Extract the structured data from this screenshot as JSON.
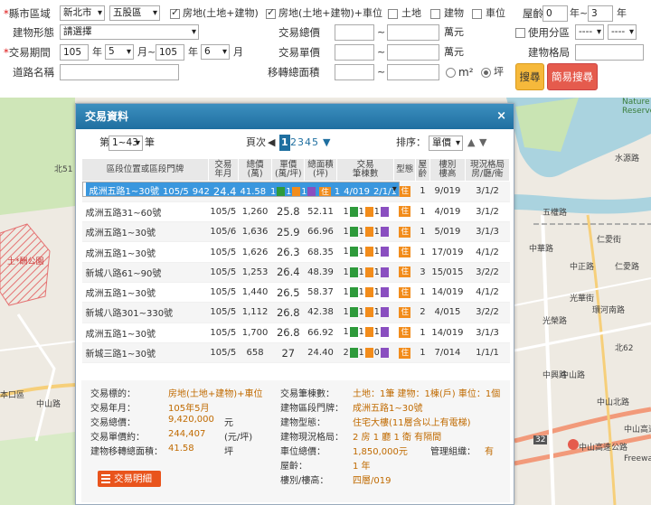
{
  "form": {
    "city_label": "縣市區域",
    "city": "新北市",
    "district": "五股區",
    "chk_land_building": "房地(土地+建物)",
    "chk_land_building_parking": "房地(土地+建物)+車位",
    "chk_land": "土地",
    "chk_building": "建物",
    "chk_parking": "車位",
    "age_label": "屋齡",
    "age_from": "0",
    "age_mid": "年~",
    "age_to": "3",
    "age_unit": "年",
    "type_label": "建物形態",
    "type_value": "請選擇",
    "total_price_label": "交易總價",
    "total_unit": "萬元",
    "zone_label": "使用分區",
    "zone_a": "----",
    "zone_b": "----",
    "period_label": "交易期間",
    "y1": "105",
    "m1": "5",
    "y2": "105",
    "m2": "6",
    "year_txt": "年",
    "month_tilde": "月~",
    "month_txt": "月",
    "unit_price_label": "交易單價",
    "unit_price_unit": "萬元",
    "layout_label": "建物格局",
    "road_label": "道路名稱",
    "area_label": "移轉總面積",
    "tilde": "~",
    "unit_m2": "m²",
    "unit_ping": "坪",
    "search_btn": "搜尋",
    "simple_btn": "簡易搜尋"
  },
  "map": {
    "labels": [
      "北51",
      "中山路",
      "中山高速公路",
      "環河南路",
      "仁愛路",
      "光榮路",
      "中正路",
      "中興路",
      "中山北路",
      "Nature",
      "Reserve",
      "水源路",
      "五權路",
      "北62",
      "中山路",
      "仁愛街",
      "光華街",
      "本口區",
      "中山高速公路",
      "中華路",
      "Freeway"
    ],
    "highway_badge": "32",
    "park_label": "土*酬公園"
  },
  "dialog": {
    "title": "交易資料",
    "close": "×",
    "page_prefix": "第",
    "page_select": "1~43",
    "page_suffix": "筆",
    "page_label": "頁次",
    "pages": [
      "1",
      "2",
      "3",
      "4",
      "5"
    ],
    "next": "▼",
    "sort_label": "排序：",
    "sort_value": "單價",
    "headers": [
      "區段位置或區段門牌",
      "交易\n年月",
      "總價\n(萬)",
      "單價\n(萬/坪)",
      "總面積\n(坪)",
      "交易\n筆棟數",
      "型態",
      "屋\n齡",
      "樓別\n樓高",
      "現況格局\n房/廳/衛"
    ],
    "type_tag": "住",
    "rows": [
      {
        "addr": "成洲五路1~30號",
        "ym": "105/5",
        "total": "942",
        "unit": "24.4",
        "area": "41.58",
        "n1": "1",
        "n2": "1",
        "n3": "1",
        "age": "1",
        "floor": "4/019",
        "layout": "2/1/1"
      },
      {
        "addr": "成洲五路31~60號",
        "ym": "105/5",
        "total": "1,238",
        "unit": "25.6",
        "area": "52.11",
        "n1": "1",
        "n2": "1",
        "n3": "1",
        "age": "1",
        "floor": "9/019",
        "layout": "3/1/2"
      },
      {
        "addr": "成洲五路31~60號",
        "ym": "105/5",
        "total": "1,260",
        "unit": "25.8",
        "area": "52.11",
        "n1": "1",
        "n2": "1",
        "n3": "1",
        "age": "1",
        "floor": "4/019",
        "layout": "3/1/2"
      },
      {
        "addr": "成洲五路1~30號",
        "ym": "105/6",
        "total": "1,636",
        "unit": "25.9",
        "area": "66.96",
        "n1": "1",
        "n2": "1",
        "n3": "1",
        "age": "1",
        "floor": "5/019",
        "layout": "3/1/3"
      },
      {
        "addr": "成洲五路1~30號",
        "ym": "105/5",
        "total": "1,626",
        "unit": "26.3",
        "area": "68.35",
        "n1": "1",
        "n2": "1",
        "n3": "1",
        "age": "1",
        "floor": "17/019",
        "layout": "4/1/2"
      },
      {
        "addr": "新城八路61~90號",
        "ym": "105/5",
        "total": "1,253",
        "unit": "26.4",
        "area": "48.39",
        "n1": "1",
        "n2": "1",
        "n3": "1",
        "age": "3",
        "floor": "15/015",
        "layout": "3/2/2"
      },
      {
        "addr": "成洲五路1~30號",
        "ym": "105/5",
        "total": "1,440",
        "unit": "26.5",
        "area": "58.37",
        "n1": "1",
        "n2": "1",
        "n3": "1",
        "age": "1",
        "floor": "14/019",
        "layout": "4/1/2"
      },
      {
        "addr": "新城八路301~330號",
        "ym": "105/5",
        "total": "1,112",
        "unit": "26.8",
        "area": "42.38",
        "n1": "1",
        "n2": "1",
        "n3": "1",
        "age": "2",
        "floor": "4/015",
        "layout": "3/2/2"
      },
      {
        "addr": "成洲五路1~30號",
        "ym": "105/5",
        "total": "1,700",
        "unit": "26.8",
        "area": "66.92",
        "n1": "1",
        "n2": "1",
        "n3": "1",
        "age": "1",
        "floor": "14/019",
        "layout": "3/1/3"
      },
      {
        "addr": "新城三路1~30號",
        "ym": "105/5",
        "total": "658",
        "unit": "27",
        "area": "24.40",
        "n1": "2",
        "n2": "1",
        "n3": "0",
        "age": "1",
        "floor": "7/014",
        "layout": "1/1/1"
      }
    ],
    "detail": {
      "l_target": "交易標的：",
      "v_target": "房地(土地+建物)+車位",
      "l_ym": "交易年月：",
      "v_ym": "105年5月",
      "l_total": "交易總價：",
      "v_total": "9,420,000",
      "u_total": "元",
      "l_unit": "交易單價約：",
      "v_unit": "244,407",
      "u_unit": "(元/坪)",
      "l_area": "建物移轉總面積：",
      "v_area": "41.58",
      "u_area": "坪",
      "l_count": "交易筆棟數：",
      "v_count": "土地：1筆 建物：1棟(戶) 車位：1個",
      "l_addr": "建物區段門牌：",
      "v_addr": "成洲五路1~30號",
      "l_type": "建物型態：",
      "v_type": "住宅大樓(11層含以上有電梯)",
      "l_layout": "建物現況格局：",
      "v_layout": "2 房 1 廳 1 衛 有隔間",
      "l_parking": "車位總價：",
      "v_parking": "1,850,000元",
      "l_mgmt": "管理組織：",
      "v_mgmt": "有",
      "l_age": "屋齡：",
      "v_age": "1 年",
      "l_floor": "樓別/樓高：",
      "v_floor": "四層/019",
      "detail_btn": "交易明細"
    }
  }
}
